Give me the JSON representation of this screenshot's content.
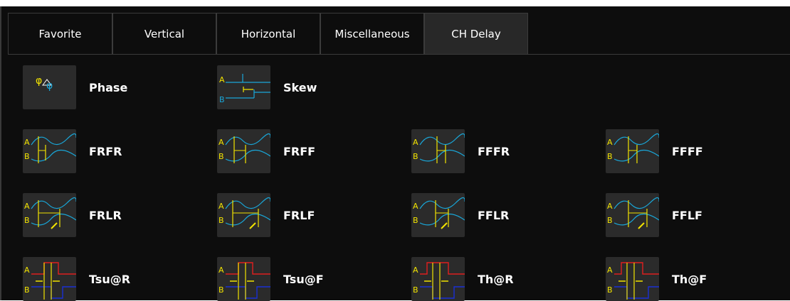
{
  "tabs": [
    {
      "label": "Favorite"
    },
    {
      "label": "Vertical"
    },
    {
      "label": "Horizontal"
    },
    {
      "label": "Miscellaneous"
    },
    {
      "label": "CH Delay"
    }
  ],
  "active_tab": "CH Delay",
  "colors": {
    "channel_a": "#f2e300",
    "channel_b": "#19a7d9",
    "ref_red": "#e01e1e",
    "ref_blue": "#1a2fd4"
  },
  "rows": [
    [
      {
        "label": "Phase",
        "icon": "phase-icon"
      },
      {
        "label": "Skew",
        "icon": "skew-icon"
      }
    ],
    [
      {
        "label": "FRFR",
        "icon": "frfr-icon"
      },
      {
        "label": "FRFF",
        "icon": "frff-icon"
      },
      {
        "label": "FFFR",
        "icon": "fffr-icon"
      },
      {
        "label": "FFFF",
        "icon": "ffff-icon"
      }
    ],
    [
      {
        "label": "FRLR",
        "icon": "frlr-icon"
      },
      {
        "label": "FRLF",
        "icon": "frlf-icon"
      },
      {
        "label": "FFLR",
        "icon": "fflr-icon"
      },
      {
        "label": "FFLF",
        "icon": "fflf-icon"
      }
    ],
    [
      {
        "label": "Tsu@R",
        "icon": "tsu-rising-icon"
      },
      {
        "label": "Tsu@F",
        "icon": "tsu-falling-icon"
      },
      {
        "label": "Th@R",
        "icon": "th-rising-icon"
      },
      {
        "label": "Th@F",
        "icon": "th-falling-icon"
      }
    ]
  ]
}
